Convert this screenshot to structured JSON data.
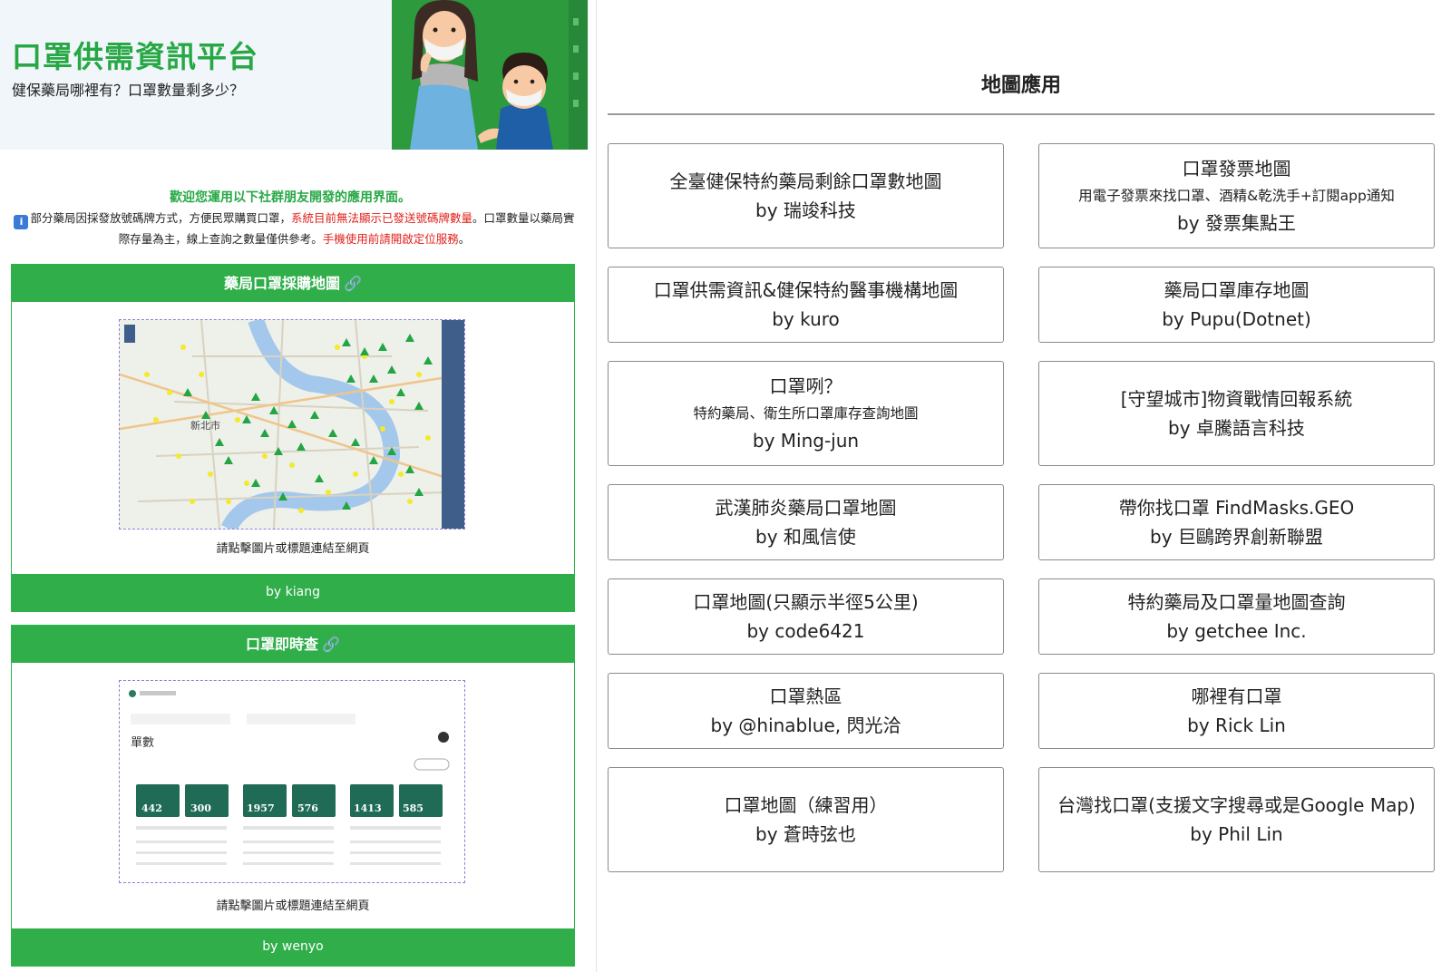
{
  "header": {
    "title": "口罩供需資訊平台",
    "subtitle": "健保藥局哪裡有？口罩數量剩多少？"
  },
  "intro": {
    "welcome": "歡迎您運用以下社群朋友開發的應用界面。",
    "notice_part1": "部分藥局因採發放號碼牌方式，方便民眾購買口罩，",
    "notice_red1": "系統目前無法顯示已發送號碼牌數量",
    "notice_part2": "。口罩數量以藥局實際存量為主，線上查詢之數量僅供參考。",
    "notice_red2": "手機使用前請開啟定位服務",
    "notice_end": "。"
  },
  "cards": [
    {
      "title": "藥局口罩採購地圖",
      "caption": "請點擊圖片或標題連結至網頁",
      "by": "by kiang",
      "map_label": "新北市"
    },
    {
      "title": "口罩即時查",
      "caption": "請點擊圖片或標題連結至網頁",
      "by": "by wenyo",
      "thumb_heading": "單數",
      "thumb_stats": [
        "442",
        "300",
        "1957",
        "576",
        "1413",
        "585"
      ]
    }
  ],
  "right": {
    "title": "地圖應用",
    "apps": [
      {
        "title": "全臺健保特約藥局剩餘口罩數地圖",
        "desc": "",
        "by": "by 瑞竣科技"
      },
      {
        "title": "口罩發票地圖",
        "desc": "用電子發票來找口罩、酒精&乾洗手+訂閱app通知",
        "by": "by 發票集點王"
      },
      {
        "title": "口罩供需資訊&健保特約醫事機構地圖",
        "desc": "",
        "by": "by kuro"
      },
      {
        "title": "藥局口罩庫存地圖",
        "desc": "",
        "by": "by Pupu(Dotnet)"
      },
      {
        "title": "口罩咧？",
        "desc": "特約藥局、衛生所口罩庫存查詢地圖",
        "by": "by Ming-jun"
      },
      {
        "title": "[守望城市]物資戰情回報系統",
        "desc": "",
        "by": "by 卓騰語言科技"
      },
      {
        "title": "武漢肺炎藥局口罩地圖",
        "desc": "",
        "by": "by 和風信使"
      },
      {
        "title": "帶你找口罩 FindMasks.GEO",
        "desc": "",
        "by": "by 巨鷗跨界創新聯盟"
      },
      {
        "title": "口罩地圖(只顯示半徑5公里)",
        "desc": "",
        "by": "by code6421"
      },
      {
        "title": "特約藥局及口罩量地圖查詢",
        "desc": "",
        "by": "by getchee Inc."
      },
      {
        "title": "口罩熱區",
        "desc": "",
        "by": "by @hinablue, 閃光洽"
      },
      {
        "title": "哪裡有口罩",
        "desc": "",
        "by": "by Rick Lin"
      },
      {
        "title": "口罩地圖（練習用）",
        "desc": "",
        "by": "by 蒼時弦也"
      },
      {
        "title": "台灣找口罩(支援文字搜尋或是Google Map)",
        "desc": "",
        "by": "by Phil Lin"
      }
    ]
  }
}
